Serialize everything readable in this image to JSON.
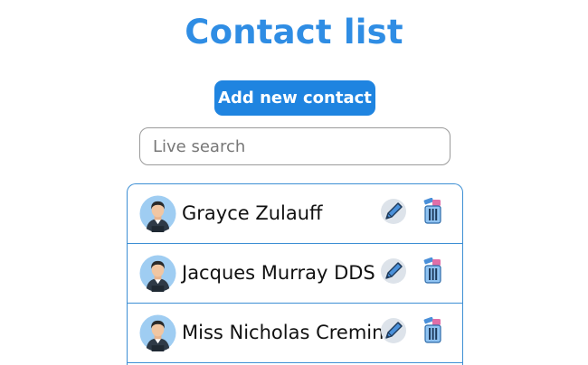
{
  "header": {
    "title": "Contact list"
  },
  "actions": {
    "add_label": "Add new contact"
  },
  "search": {
    "placeholder": "Live search",
    "value": ""
  },
  "contacts": [
    {
      "name": "Grayce Zulauff",
      "avatar_icon": "person-avatar-icon",
      "edit_icon": "pencil-icon",
      "delete_icon": "trash-icon"
    },
    {
      "name": "Jacques Murray DDS",
      "avatar_icon": "person-avatar-icon",
      "edit_icon": "pencil-icon",
      "delete_icon": "trash-icon"
    },
    {
      "name": "Miss Nicholas Cremin",
      "avatar_icon": "person-avatar-icon",
      "edit_icon": "pencil-icon",
      "delete_icon": "trash-icon"
    }
  ],
  "colors": {
    "accent": "#2f8de4",
    "button": "#1f84e0",
    "list_border": "#3d8fd4"
  }
}
